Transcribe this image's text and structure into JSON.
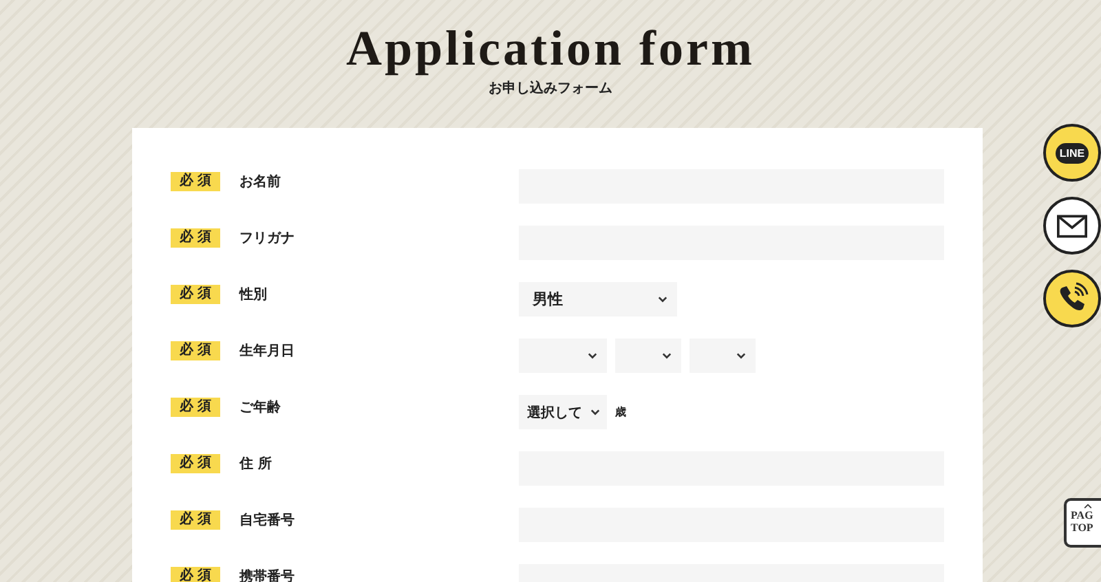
{
  "header": {
    "title": "Application form",
    "subtitle": "お申し込みフォーム"
  },
  "rows": [
    {
      "badge": "必 須",
      "label": "お名前",
      "kind": "text"
    },
    {
      "badge": "必 須",
      "label": "フリガナ",
      "kind": "text"
    },
    {
      "badge": "必 須",
      "label": "性別",
      "kind": "select",
      "value": "男性"
    },
    {
      "badge": "必 須",
      "label": "生年月日",
      "kind": "date"
    },
    {
      "badge": "必 須",
      "label": "ご年齢",
      "kind": "age",
      "value": "選択して",
      "unit": "歳"
    },
    {
      "badge": "必 須",
      "label": "住 所",
      "kind": "text"
    },
    {
      "badge": "必 須",
      "label": "自宅番号",
      "kind": "text"
    },
    {
      "badge": "必 須",
      "label": "携帯番号",
      "kind": "text"
    }
  ],
  "side_buttons": [
    {
      "kind": "line",
      "label": "LINE"
    },
    {
      "kind": "mail"
    },
    {
      "kind": "phone"
    }
  ],
  "page_top": {
    "lines": [
      "PAG",
      "TOP"
    ]
  }
}
